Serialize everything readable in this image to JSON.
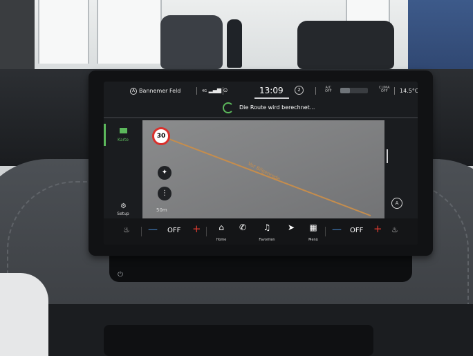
{
  "status_bar": {
    "location": "Bannemer Feld",
    "signal": "4G",
    "time": "13:09",
    "notification_count": "2",
    "ac": {
      "label": "A/C",
      "state": "OFF"
    },
    "clima": {
      "label": "CLIMA",
      "state": "OFF"
    },
    "outside_temp": "14.5°C",
    "fan_level": 0.35
  },
  "route_status": "Die Route wird berechnet...",
  "left_rail": {
    "map_tab": "Karte",
    "setup_tab": "Setup"
  },
  "map": {
    "speed_limit": "30",
    "street_name": "Vor Bilgenrode",
    "scale": "50m"
  },
  "bottom_bar": {
    "left_seat_heat": "OFF",
    "home_label": "Home",
    "favorites_label": "Favoriten",
    "menu_label": "Menü",
    "right_seat_heat": "OFF"
  },
  "colors": {
    "accent_green": "#5cb85c",
    "minus_blue": "#4a90d9",
    "plus_red": "#e03c31",
    "route_orange": "#c58d4d"
  }
}
